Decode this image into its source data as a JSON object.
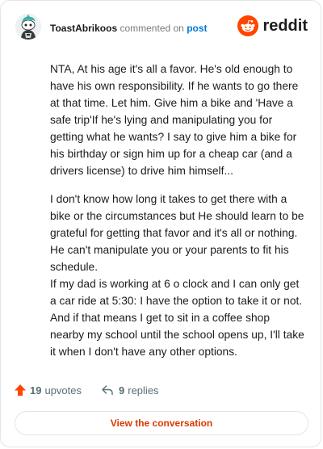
{
  "header": {
    "username": "ToastAbrikoos",
    "action_text": "commented on",
    "post_link_text": "post",
    "brand_name": "reddit",
    "brand_color": "#ff4500",
    "avatar_icon": "snoo-avatar-icon"
  },
  "comment": {
    "paragraphs": [
      "NTA, At his age it's all a favor. He's old enough to have his own responsibility. If he wants to go there at that time. Let him. Give him a bike and 'Have a safe trip'If he's lying and manipulating you for getting what he wants? I say to give him a bike for his birthday or sign him up for a cheap car (and a drivers license) to drive him himself...",
      "I don't know how long it takes to get there with a bike or the circumstances but He should learn to be grateful for getting that favor and it's all or nothing. He can't manipulate you or your parents to fit his schedule.\nIf my dad is working at 6 o clock and I can only get a car ride at 5:30: I have the option to take it or not. And if that means I get to sit in a coffee shop nearby my school until the school opens up, I'll take it when I don't have any other options."
    ]
  },
  "stats": {
    "upvote_count": "19",
    "upvote_label": "upvotes",
    "reply_count": "9",
    "reply_label": "replies",
    "upvote_icon": "upvote-arrow-icon",
    "reply_icon": "reply-arrow-icon",
    "upvote_color": "#ff4500"
  },
  "cta": {
    "label": "View the conversation",
    "color": "#d93a00"
  }
}
